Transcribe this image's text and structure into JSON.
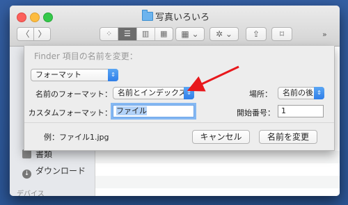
{
  "window": {
    "title": "写真いろいろ"
  },
  "toolbar": {
    "back_label": "〈",
    "forward_label": "〉",
    "views": [
      {
        "icon": "icon-view-icon",
        "glyph": "⁘"
      },
      {
        "icon": "list-view-icon",
        "glyph": "☰"
      },
      {
        "icon": "column-view-icon",
        "glyph": "▥"
      },
      {
        "icon": "coverflow-view-icon",
        "glyph": "▦"
      }
    ],
    "arrange_glyph": "▦ ⌄",
    "action_glyph": "✲ ⌄",
    "share_glyph": "⇪",
    "tags_glyph": "⌑",
    "more_glyph": "»"
  },
  "sidebar": {
    "items": [
      {
        "label": "書類",
        "icon": "documents-icon"
      },
      {
        "label": "ダウンロード",
        "icon": "downloads-icon",
        "glyph": "↓"
      }
    ],
    "heading": "デバイス"
  },
  "sheet": {
    "title": "Finder 項目の名前を変更：",
    "mode_select": "フォーマット",
    "name_format_label": "名前のフォーマット：",
    "name_format_value": "名前とインデックス",
    "location_label": "場所：",
    "location_value": "名前の後",
    "custom_format_label": "カスタムフォーマット：",
    "custom_format_value": "ファイル",
    "start_number_label": "開始番号：",
    "start_number_value": "1",
    "example": "例：ファイル1.jpg",
    "cancel_label": "キャンセル",
    "rename_label": "名前を変更"
  },
  "colors": {
    "select_accent": "#2f7ee8",
    "annotation_arrow": "#e8181c",
    "desktop": "#2f5a9c"
  }
}
